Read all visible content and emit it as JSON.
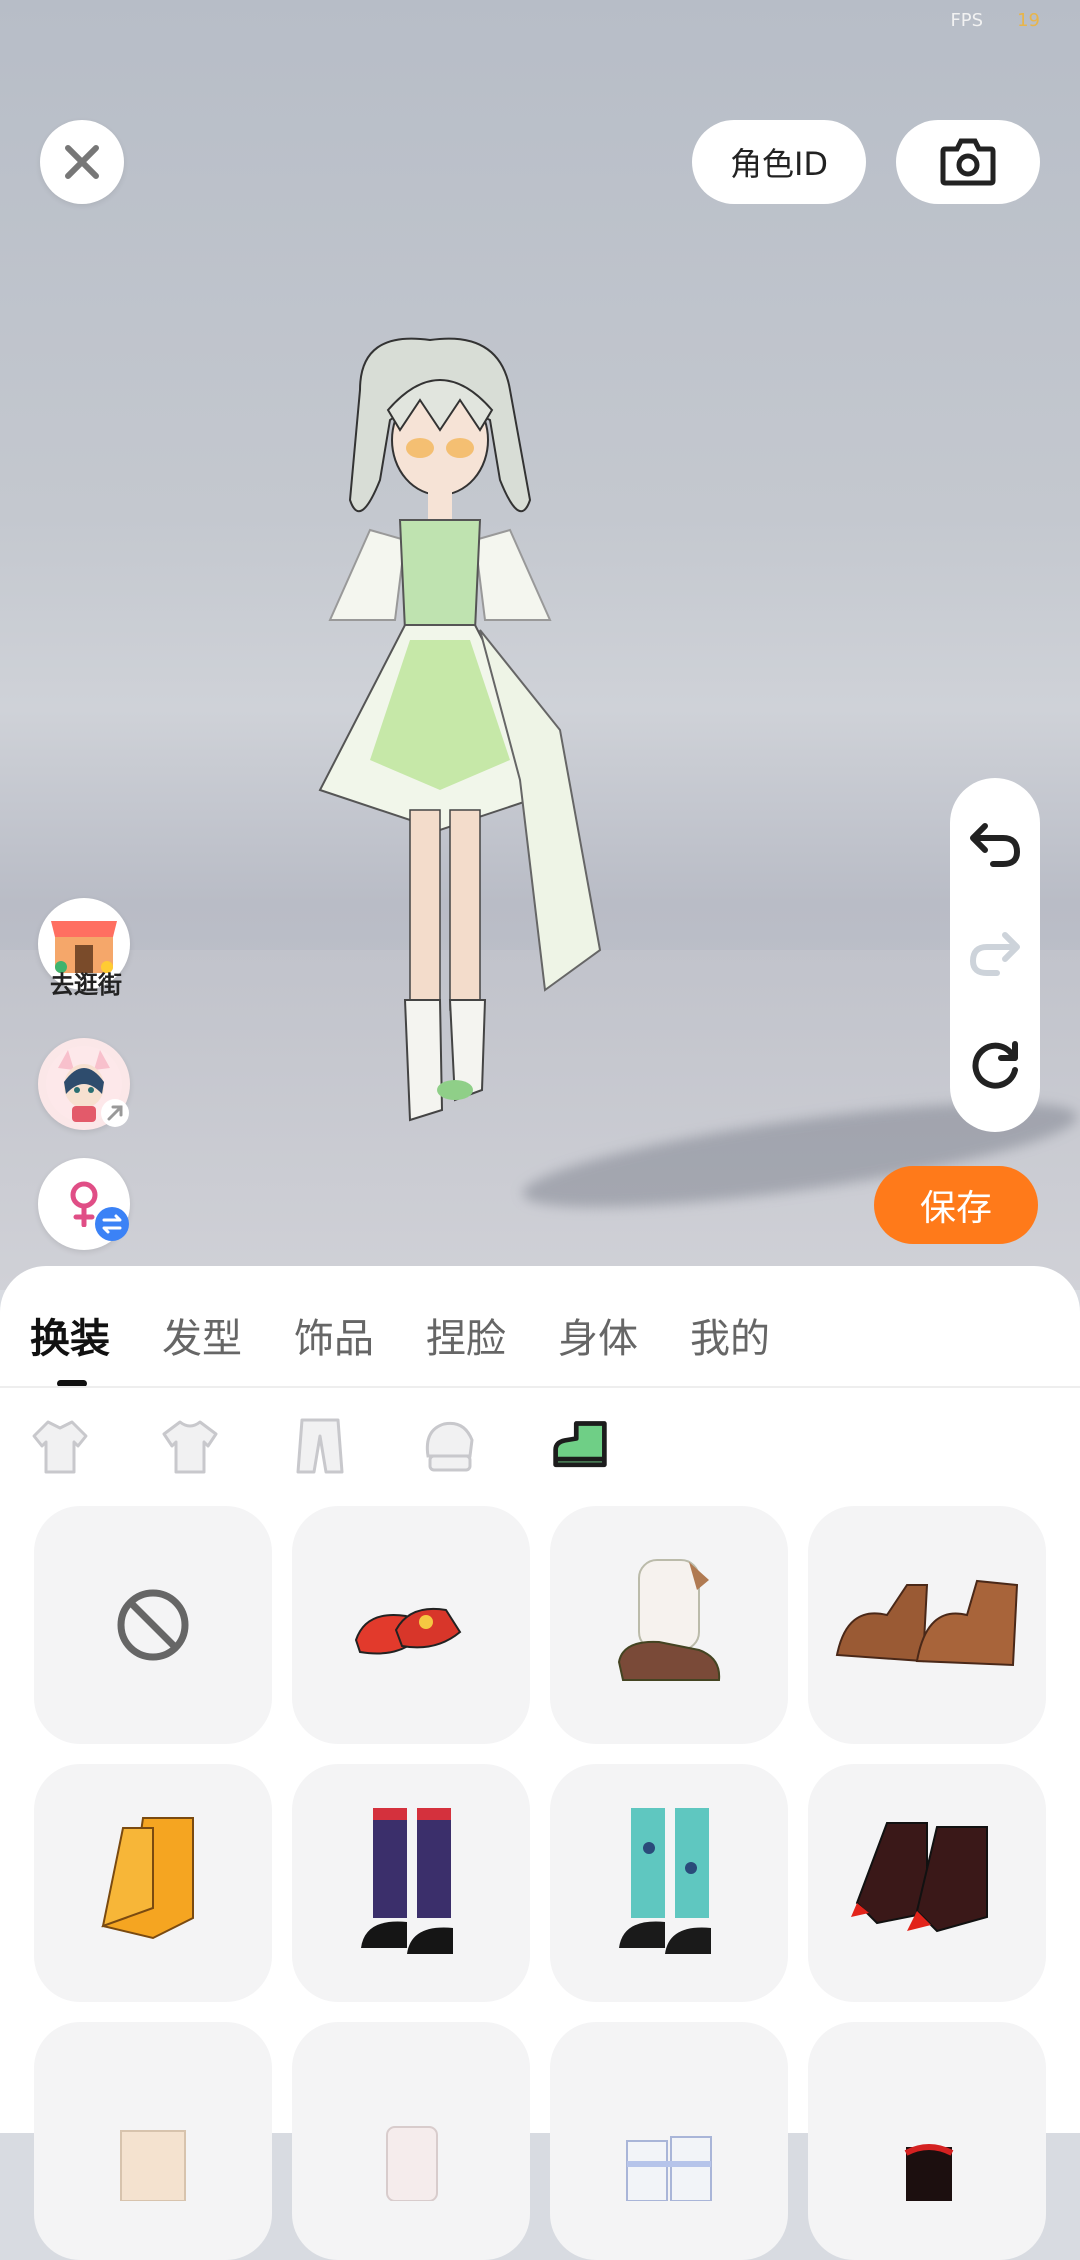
{
  "status": {
    "fps_label": "FPS",
    "fps_value": "19"
  },
  "header": {
    "role_id_label": "角色ID"
  },
  "side": {
    "shop_label": "去逛街",
    "save_label": "保存"
  },
  "tabs": [
    "换装",
    "发型",
    "饰品",
    "捏脸",
    "身体",
    "我的"
  ],
  "active_tab": "换装",
  "subcategories": [
    "top-icon",
    "shirt-icon",
    "pants-icon",
    "glove-icon",
    "shoe-icon"
  ],
  "active_subcategory": "shoe-icon",
  "items": [
    {
      "name": "none-icon"
    },
    {
      "name": "red-flat-shoes"
    },
    {
      "name": "white-furry-boots"
    },
    {
      "name": "brown-paw-boots"
    },
    {
      "name": "yellow-claw-boots"
    },
    {
      "name": "argyle-socks-shoes"
    },
    {
      "name": "teal-socks-shoes"
    },
    {
      "name": "red-claw-boots"
    },
    {
      "name": "cream-knit-socks"
    },
    {
      "name": "white-socks"
    },
    {
      "name": "striped-white-boots"
    },
    {
      "name": "red-black-boots"
    }
  ],
  "colors": {
    "save_button": "#ff7a1a",
    "accent_green": "#5fbf6c"
  }
}
